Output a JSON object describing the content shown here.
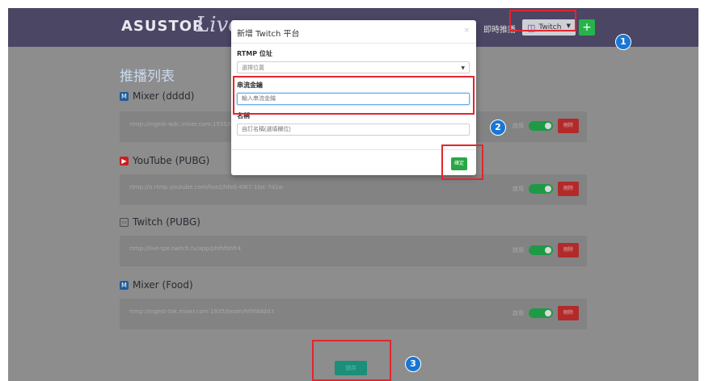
{
  "header": {
    "logo_text": "ASUSTOR",
    "logo_live": "Live",
    "live_label": "即時推播",
    "platform_select_value": "Twitch",
    "add_label": "+"
  },
  "main": {
    "list_title": "推播列表",
    "groups": [
      {
        "title": "Mixer (dddd)",
        "icon": "mixer-icon",
        "url": "rtmp://ingest-wdc.mixer.com:1935/beam/...",
        "enable_label": "啟用",
        "delete_label": "刪除"
      },
      {
        "title": "YouTube (PUBG)",
        "icon": "youtube-icon",
        "url": "rtmp://a.rtmp.youtube.com/live2/hfe0-49t7-1tsc-7d1w",
        "enable_label": "啟用",
        "delete_label": "刪除"
      },
      {
        "title": "Twitch (PUBG)",
        "icon": "twitch-icon",
        "url": "rtmp://live-tpe.twitch.tv/app/phfhfbhfr4",
        "enable_label": "啟用",
        "delete_label": "刪除"
      },
      {
        "title": "Mixer (Food)",
        "icon": "mixer-icon",
        "url": "rtmp://ingest-tok.mixer.com:1935/beam/hfhfdddd:t",
        "enable_label": "啟用",
        "delete_label": "刪除"
      }
    ],
    "save_label": "儲存"
  },
  "modal": {
    "title": "新增 Twitch 平台",
    "close": "×",
    "rtmp_label": "RTMP 位址",
    "rtmp_select_value": "選擇位置",
    "stream_key_label": "串流金鑰",
    "stream_key_placeholder": "輸入串流金鑰",
    "name_label": "名稱",
    "name_placeholder": "自訂名稱(選填欄位)",
    "ok_label": "確定"
  },
  "callouts": [
    "1",
    "2",
    "3"
  ],
  "colors": {
    "header_bg": "#4b4664",
    "overlay_bg": "#8d8d8d",
    "highlight": "#e2262d",
    "accent_green": "#28a745",
    "badge_blue": "#1976d2"
  }
}
